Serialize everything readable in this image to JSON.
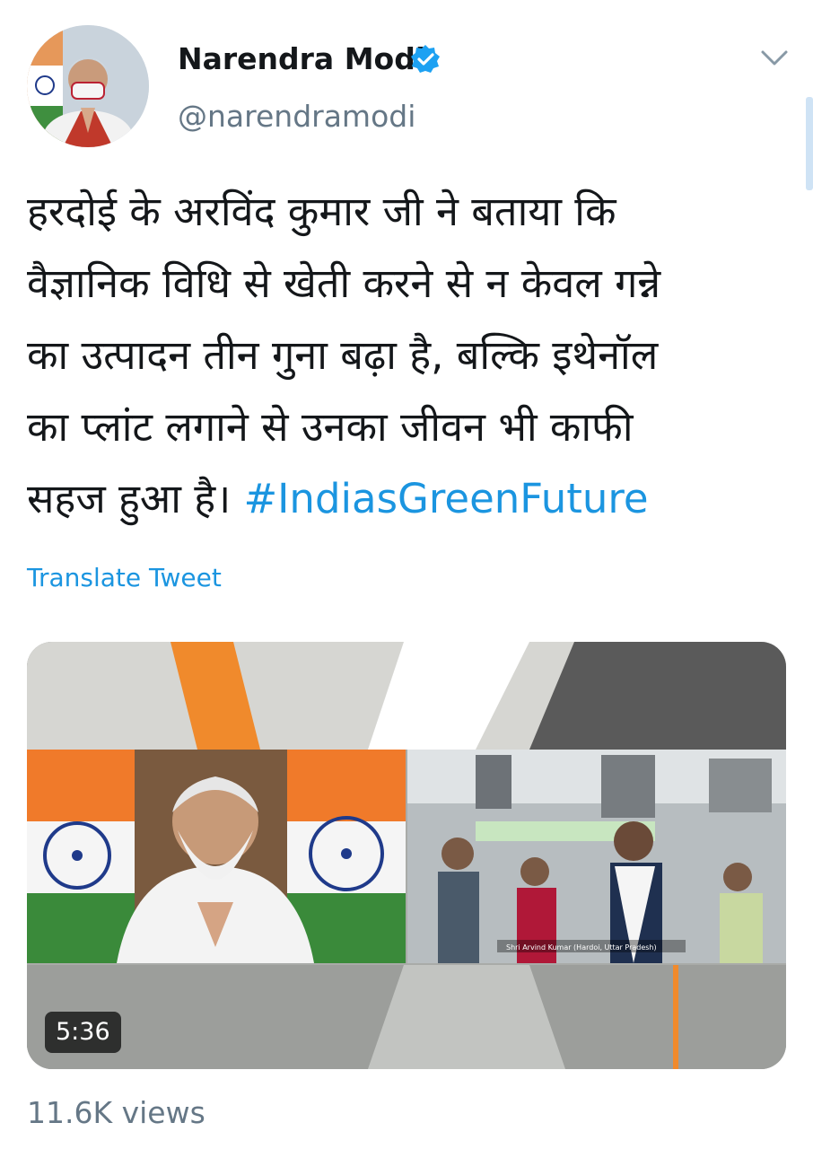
{
  "author": {
    "display_name": "Narendra Modi",
    "handle": "@narendramodi",
    "verified_icon": "verified-badge-icon",
    "verified_color": "#1da1f2",
    "avatar_icon": "profile-photo-avatar"
  },
  "menu": {
    "icon": "chevron-down-icon"
  },
  "tweet": {
    "lines": [
      "हरदोई के अरविंद कुमार जी ने बताया कि",
      "वैज्ञानिक विधि से खेती करने से न केवल गन्ने",
      "का उत्पादन तीन गुना बढ़ा है, बल्कि इथेनॉल",
      "का प्लांट लगाने से उनका जीवन भी काफी"
    ],
    "last_line_text": "सहज हुआ है। ",
    "hashtag": "#IndiasGreenFuture",
    "link_color": "#1b95e0",
    "translate_label": "Translate Tweet"
  },
  "media": {
    "duration": "5:36",
    "caption": "Shri Arvind Kumar (Hardoi, Uttar Pradesh)"
  },
  "stats": {
    "views": "11.6K views"
  }
}
